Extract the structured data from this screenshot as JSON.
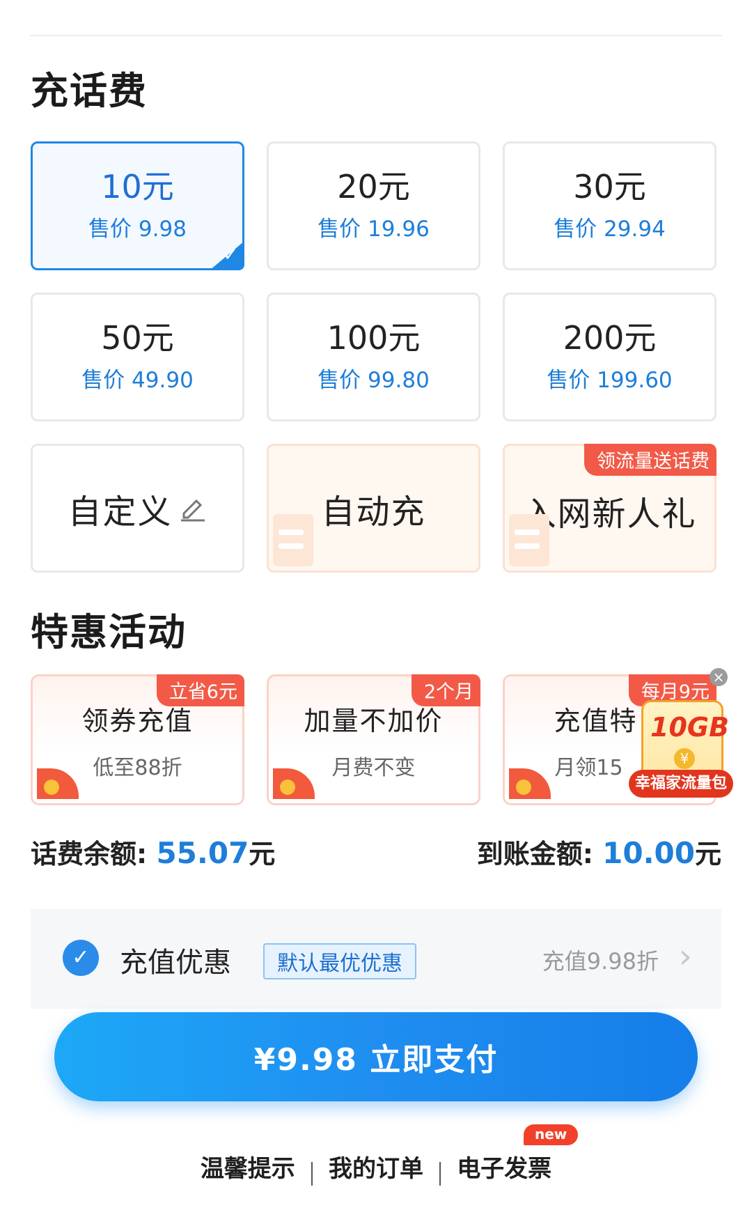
{
  "recharge": {
    "title": "充话费",
    "options": [
      {
        "amount": "10元",
        "price": "售价 9.98",
        "selected": true
      },
      {
        "amount": "20元",
        "price": "售价 19.96"
      },
      {
        "amount": "30元",
        "price": "售价 29.94"
      },
      {
        "amount": "50元",
        "price": "售价 49.90"
      },
      {
        "amount": "100元",
        "price": "售价 99.80"
      },
      {
        "amount": "200元",
        "price": "售价 199.60"
      }
    ],
    "custom_label": "自定义",
    "auto_label": "自动充",
    "new_user_label": "入网新人礼",
    "new_user_ribbon": "领流量送话费"
  },
  "promotions": {
    "title": "特惠活动",
    "items": [
      {
        "ribbon": "立省6元",
        "title": "领券充值",
        "subtitle": "低至88折"
      },
      {
        "ribbon": "2个月",
        "title": "加量不加价",
        "subtitle": "月费不变"
      },
      {
        "ribbon": "每月9元",
        "title": "充值特",
        "subtitle": "月领15"
      }
    ],
    "ad": {
      "gb": "10GB",
      "banner": "幸福家流量包",
      "close": "×",
      "yuan": "¥"
    }
  },
  "balance": {
    "label": "话费余额:",
    "value": "55.07",
    "unit": "元",
    "arrival_label": "到账金额:",
    "arrival_value": "10.00",
    "arrival_unit": "元"
  },
  "discount": {
    "title": "充值优惠",
    "tag": "默认最优优惠",
    "detail": "充值9.98折"
  },
  "pay": {
    "label": "¥9.98 立即支付"
  },
  "footer": {
    "links": [
      "温馨提示",
      "我的订单",
      "电子发票"
    ],
    "new_badge": "new"
  },
  "colors": {
    "accent": "#1f88e5",
    "price": "#1e7ed9",
    "ribbon": "#f25a47"
  }
}
